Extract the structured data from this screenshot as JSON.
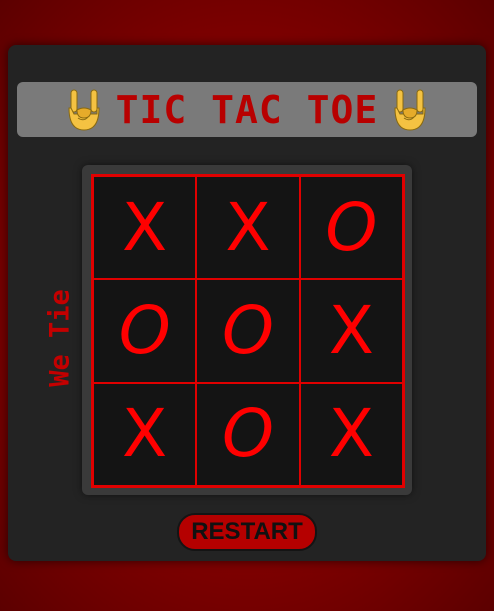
{
  "title": "TIC TAC TOE",
  "title_icon": "sign-of-the-horns-icon",
  "status_text": "We Tie",
  "restart_label": "RESTART",
  "board": [
    [
      "X",
      "X",
      "O"
    ],
    [
      "O",
      "O",
      "X"
    ],
    [
      "X",
      "O",
      "X"
    ]
  ],
  "colors": {
    "background": "#8a0000",
    "panel": "#232323",
    "title_bar": "#7a7a7a",
    "accent_red": "#ff0000",
    "grid_line": "#e00000",
    "cell_bg": "#141414",
    "restart_bg": "#b50000"
  }
}
